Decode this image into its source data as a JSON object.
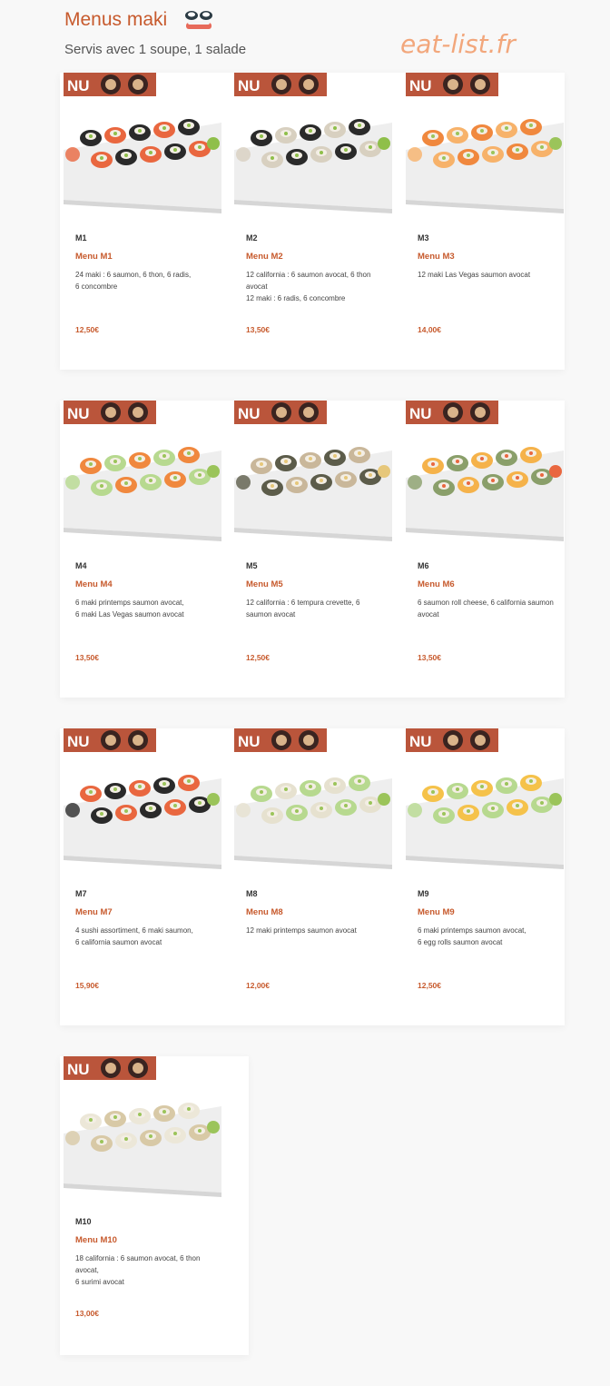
{
  "header": {
    "title": "Menus maki",
    "subtitle": "Servis avec 1 soupe, 1 salade",
    "watermark": "eat-list.fr"
  },
  "colors": {
    "accent": "#c75a2d",
    "watermark": "#f2a77c",
    "badge": "#b4472a"
  },
  "menus": [
    {
      "code": "M1",
      "name": "Menu M1",
      "desc": "24 maki : 6 saumon, 6 thon, 6 radis,\n6 concombre",
      "price": "12,50€"
    },
    {
      "code": "M2",
      "name": "Menu M2",
      "desc": "12 california : 6 saumon avocat, 6 thon avocat\n12 maki : 6 radis, 6 concombre",
      "price": "13,50€"
    },
    {
      "code": "M3",
      "name": "Menu M3",
      "desc": "12 maki Las Vegas saumon avocat",
      "price": "14,00€"
    },
    {
      "code": "M4",
      "name": "Menu M4",
      "desc": "6 maki printemps saumon avocat,\n6 maki Las Vegas saumon avocat",
      "price": "13,50€"
    },
    {
      "code": "M5",
      "name": "Menu M5",
      "desc": "12 california : 6 tempura crevette, 6 saumon avocat",
      "price": "12,50€"
    },
    {
      "code": "M6",
      "name": "Menu M6",
      "desc": "6 saumon roll cheese, 6 california saumon avocat",
      "price": "13,50€"
    },
    {
      "code": "M7",
      "name": "Menu M7",
      "desc": "4 sushi assortiment, 6 maki saumon,\n6 california saumon avocat",
      "price": "15,90€"
    },
    {
      "code": "M8",
      "name": "Menu M8",
      "desc": "12 maki printemps saumon avocat",
      "price": "12,00€"
    },
    {
      "code": "M9",
      "name": "Menu M9",
      "desc": "6 maki printemps saumon avocat,\n6 egg rolls saumon avocat",
      "price": "12,50€"
    },
    {
      "code": "M10",
      "name": "Menu M10",
      "desc": "18 california : 6 saumon avocat, 6 thon avocat,\n6 surimi avocat",
      "price": "13,00€"
    }
  ],
  "badge_text": "NU"
}
